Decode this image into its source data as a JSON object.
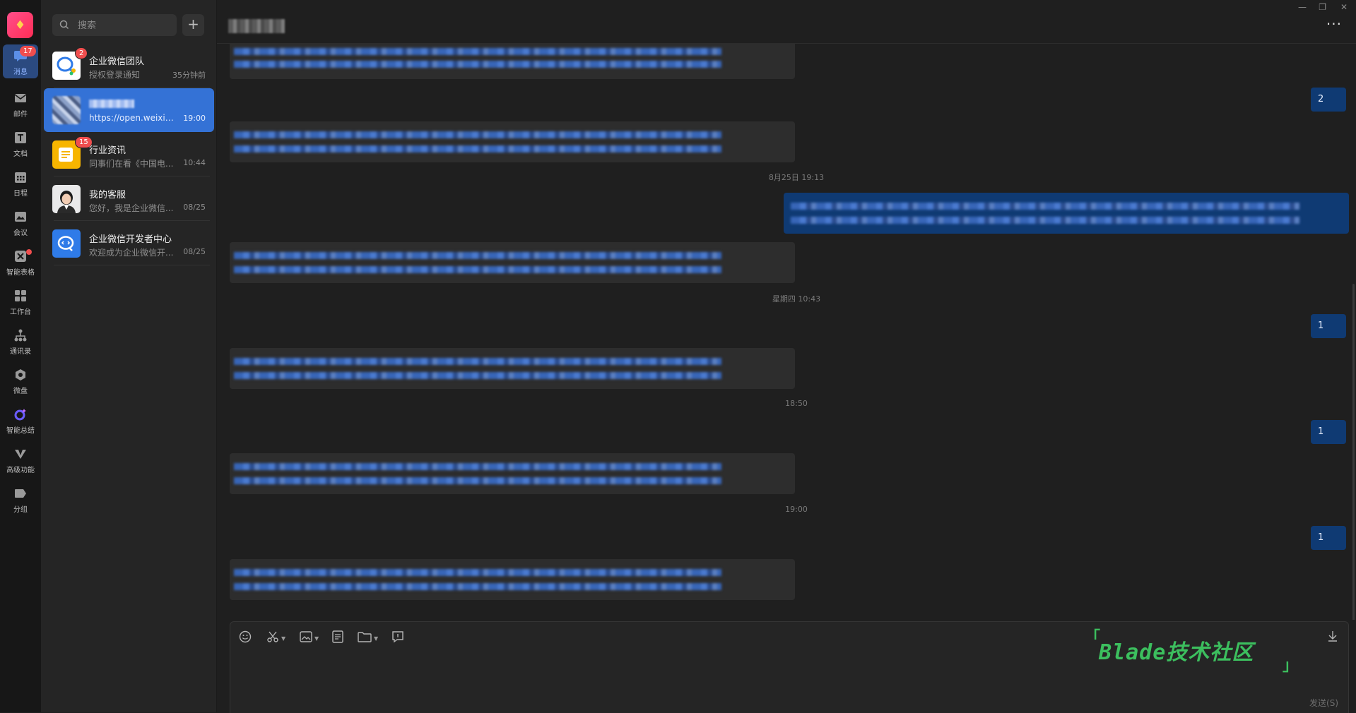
{
  "window": {
    "minimize_glyph": "—",
    "restore_glyph": "❐",
    "close_glyph": "✕",
    "more_glyph": "···"
  },
  "rail": {
    "items": [
      {
        "label": "消息",
        "icon": "chat-bubble-icon",
        "badge": "17",
        "active": true
      },
      {
        "label": "邮件",
        "icon": "mail-icon"
      },
      {
        "label": "文档",
        "icon": "document-icon"
      },
      {
        "label": "日程",
        "icon": "calendar-icon"
      },
      {
        "label": "会议",
        "icon": "meeting-icon"
      },
      {
        "label": "智能表格",
        "icon": "smart-sheet-icon",
        "dot": true
      },
      {
        "label": "工作台",
        "icon": "workbench-icon"
      },
      {
        "label": "通讯录",
        "icon": "contacts-icon"
      },
      {
        "label": "微盘",
        "icon": "drive-icon"
      },
      {
        "label": "智能总结",
        "icon": "ai-summary-icon"
      },
      {
        "label": "高级功能",
        "icon": "advanced-features-icon"
      },
      {
        "label": "分组",
        "icon": "group-tag-icon"
      }
    ]
  },
  "search": {
    "placeholder": "搜索",
    "add_label": "+"
  },
  "conversations": [
    {
      "title": "企业微信团队",
      "preview": "授权登录通知",
      "time": "35分钟前",
      "badge": "2"
    },
    {
      "title": "",
      "preview": "https://open.weixin....",
      "time": "19:00",
      "active": true
    },
    {
      "title": "行业资讯",
      "preview": "同事们在看《中国电...",
      "time": "10:44",
      "badge": "15"
    },
    {
      "title": "我的客服",
      "preview": "您好，我是企业微信...",
      "time": "08/25"
    },
    {
      "title": "企业微信开发者中心",
      "preview": "欢迎成为企业微信开...",
      "time": "08/25"
    }
  ],
  "chat": {
    "outgoing_numbers": [
      "2",
      "1",
      "1",
      "1"
    ],
    "timestamps": [
      "8月25日 19:13",
      "星期四 10:43",
      "18:50",
      "19:00"
    ]
  },
  "composer": {
    "send_label": "发送(S)"
  },
  "watermark": {
    "text": "Blade技术社区",
    "open_bracket": "「",
    "close_bracket": "」"
  },
  "colors": {
    "accent": "#3472d6",
    "outgoing_bubble": "#0f3a73",
    "badge": "#f04e4e",
    "watermark": "#3cbf5e"
  }
}
